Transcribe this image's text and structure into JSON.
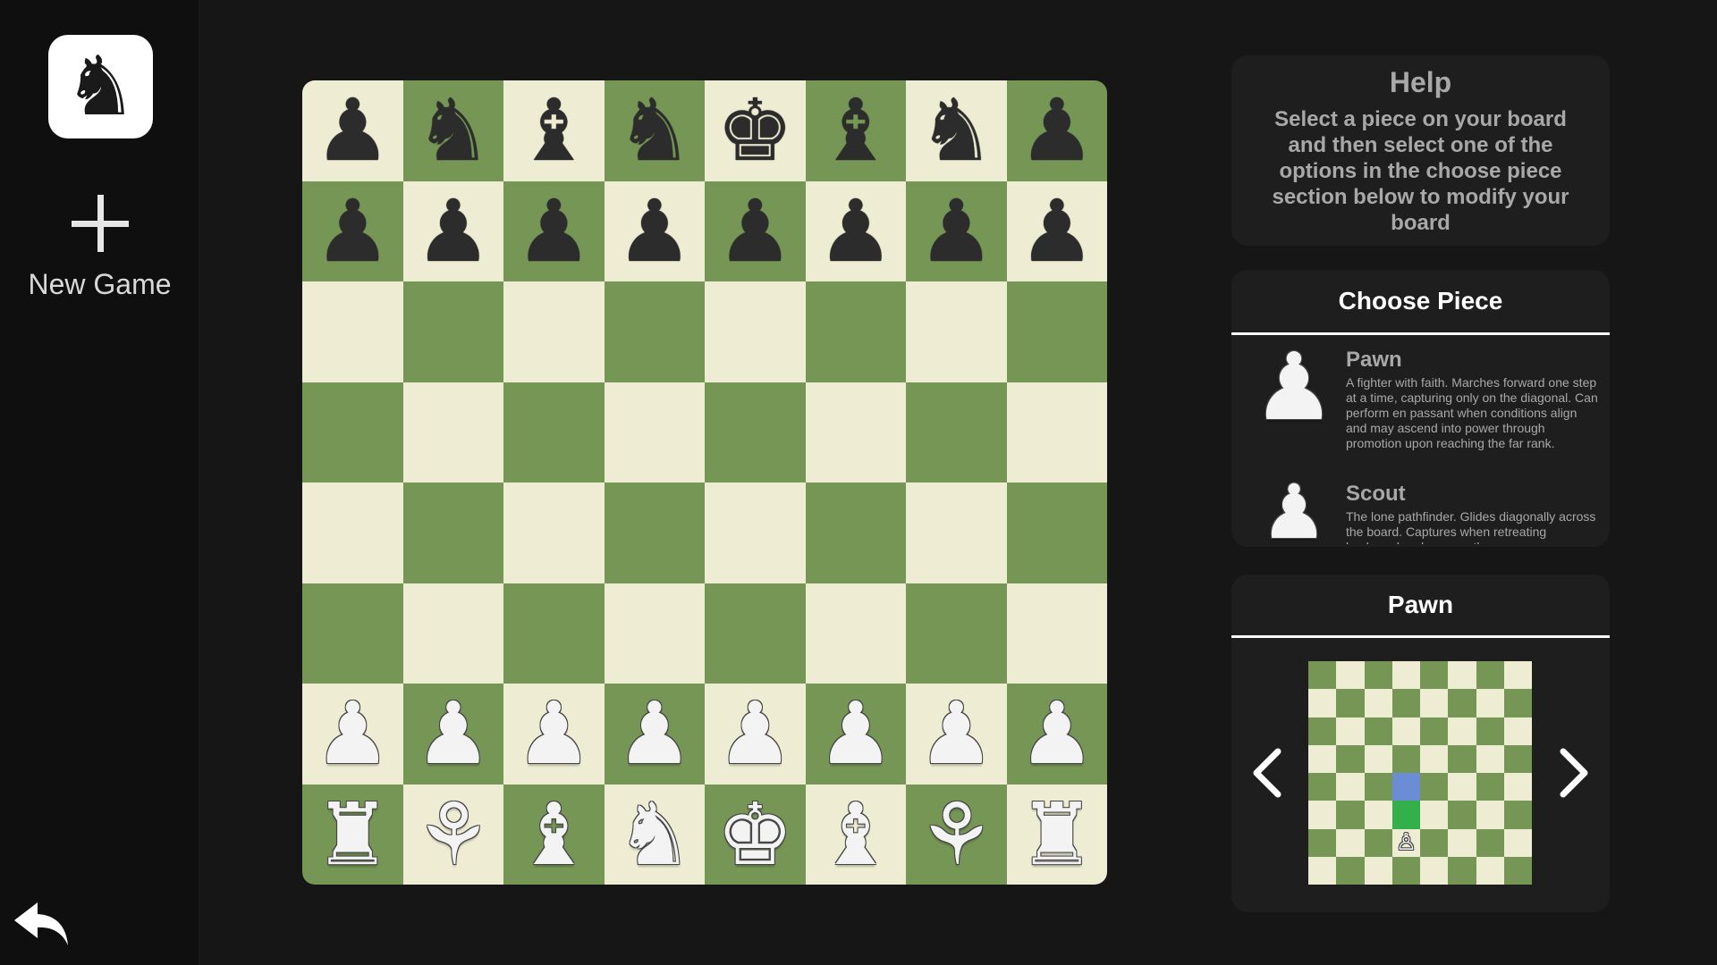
{
  "sidebar": {
    "logo_icon": "winged-knight-icon",
    "logo_glyph": "♞",
    "new_game_label": "New Game",
    "plus_icon": "plus-icon",
    "undo_icon": "undo-arrow-icon"
  },
  "board": {
    "light_color": "#eeedd3",
    "dark_color": "#769656",
    "pieces": [
      [
        "♟",
        "♞",
        "♝",
        "♞",
        "♚",
        "♝",
        "♞",
        "♟"
      ],
      [
        "♟",
        "♟",
        "♟",
        "♟",
        "♟",
        "♟",
        "♟",
        "♟"
      ],
      [
        "",
        "",
        "",
        "",
        "",
        "",
        "",
        ""
      ],
      [
        "",
        "",
        "",
        "",
        "",
        "",
        "",
        ""
      ],
      [
        "",
        "",
        "",
        "",
        "",
        "",
        "",
        ""
      ],
      [
        "",
        "",
        "",
        "",
        "",
        "",
        "",
        ""
      ],
      [
        "♟",
        "♟",
        "♟",
        "♟",
        "♟",
        "♟",
        "♟",
        "♟"
      ],
      [
        "♜",
        "⚘",
        "♝",
        "♞",
        "♚",
        "♝",
        "⚘",
        "♜"
      ]
    ],
    "piece_names": [
      [
        "pawn",
        "knight",
        "bishop",
        "pegasus",
        "king",
        "bishop",
        "knight",
        "pawn"
      ],
      [
        "pawn",
        "pawn",
        "pawn",
        "pawn",
        "pawn",
        "pawn",
        "pawn",
        "pawn"
      ],
      [
        "",
        "",
        "",
        "",
        "",
        "",
        "",
        ""
      ],
      [
        "",
        "",
        "",
        "",
        "",
        "",
        "",
        ""
      ],
      [
        "",
        "",
        "",
        "",
        "",
        "",
        "",
        ""
      ],
      [
        "",
        "",
        "",
        "",
        "",
        "",
        "",
        ""
      ],
      [
        "pawn",
        "pawn",
        "pawn",
        "pawn",
        "pawn",
        "pawn",
        "pawn",
        "pawn"
      ],
      [
        "rook",
        "fairy",
        "crusader-bishop",
        "ranger-knight",
        "king",
        "crusader-bishop",
        "fairy",
        "rook"
      ]
    ],
    "black_rows": [
      0,
      1
    ],
    "white_rows": [
      6,
      7
    ]
  },
  "help": {
    "title": "Help",
    "text": "Select a piece on your board and then select one of the options in the choose piece section below to modify your board"
  },
  "choose_piece": {
    "title": "Choose Piece",
    "options": [
      {
        "name": "Pawn",
        "glyph": "♟",
        "description": "A fighter with faith. Marches forward one step at a time, capturing only on the diagonal. Can perform en passant when conditions align and may ascend into power through promotion upon reaching the far rank."
      },
      {
        "name": "Scout",
        "glyph": "♟",
        "description": "The lone pathfinder. Glides diagonally across the board. Captures when retreating backward and sweeps the"
      }
    ]
  },
  "preview": {
    "title": "Pawn",
    "piece_glyph": "♙",
    "move_color": "#6b8dd6",
    "capture_color": "#34b04a",
    "move_squares": [
      [
        4,
        3
      ]
    ],
    "capture_squares": [
      [
        5,
        3
      ]
    ],
    "piece_square": [
      6,
      3
    ],
    "prev_icon": "chevron-left-icon",
    "next_icon": "chevron-right-icon"
  }
}
